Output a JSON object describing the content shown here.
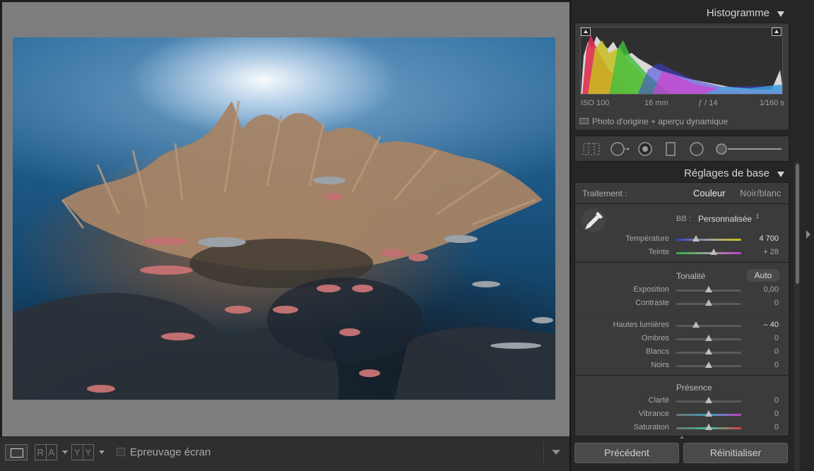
{
  "histogram": {
    "title": "Histogramme",
    "exif": {
      "iso": "ISO 100",
      "focal": "16 mm",
      "aperture": "ƒ / 14",
      "shutter": "1⁄160 s"
    },
    "preview_label": "Photo d'origine + aperçu dynamique"
  },
  "basic": {
    "title": "Réglages de base",
    "treatment_label": "Traitement :",
    "treatment_color": "Couleur",
    "treatment_bw": "Noir/blanc",
    "wb_label": "BB :",
    "wb_value": "Personnalisée",
    "tone_title": "Tonalité",
    "auto_label": "Auto",
    "presence_title": "Présence",
    "sliders": [
      {
        "label": "Température",
        "value": "4 700",
        "pos": 0.3
      },
      {
        "label": "Teinte",
        "value": "+ 28",
        "pos": 0.58
      },
      {
        "label": "Exposition",
        "value": "0,00",
        "pos": 0.5
      },
      {
        "label": "Contraste",
        "value": "0",
        "pos": 0.5
      },
      {
        "label": "Hautes lumières",
        "value": "– 40",
        "pos": 0.3
      },
      {
        "label": "Ombres",
        "value": "0",
        "pos": 0.5
      },
      {
        "label": "Blancs",
        "value": "0",
        "pos": 0.5
      },
      {
        "label": "Noirs",
        "value": "0",
        "pos": 0.5
      },
      {
        "label": "Clarté",
        "value": "0",
        "pos": 0.5
      },
      {
        "label": "Vibrance",
        "value": "0",
        "pos": 0.5
      },
      {
        "label": "Saturation",
        "value": "0",
        "pos": 0.5
      }
    ]
  },
  "footer": {
    "prev_label": "Précédent",
    "reset_label": "Réinitialiser"
  },
  "toolbar": {
    "ra": [
      "R",
      "A"
    ],
    "yy": [
      "Y",
      "Y"
    ],
    "softproof_label": "Epreuvage écran"
  }
}
